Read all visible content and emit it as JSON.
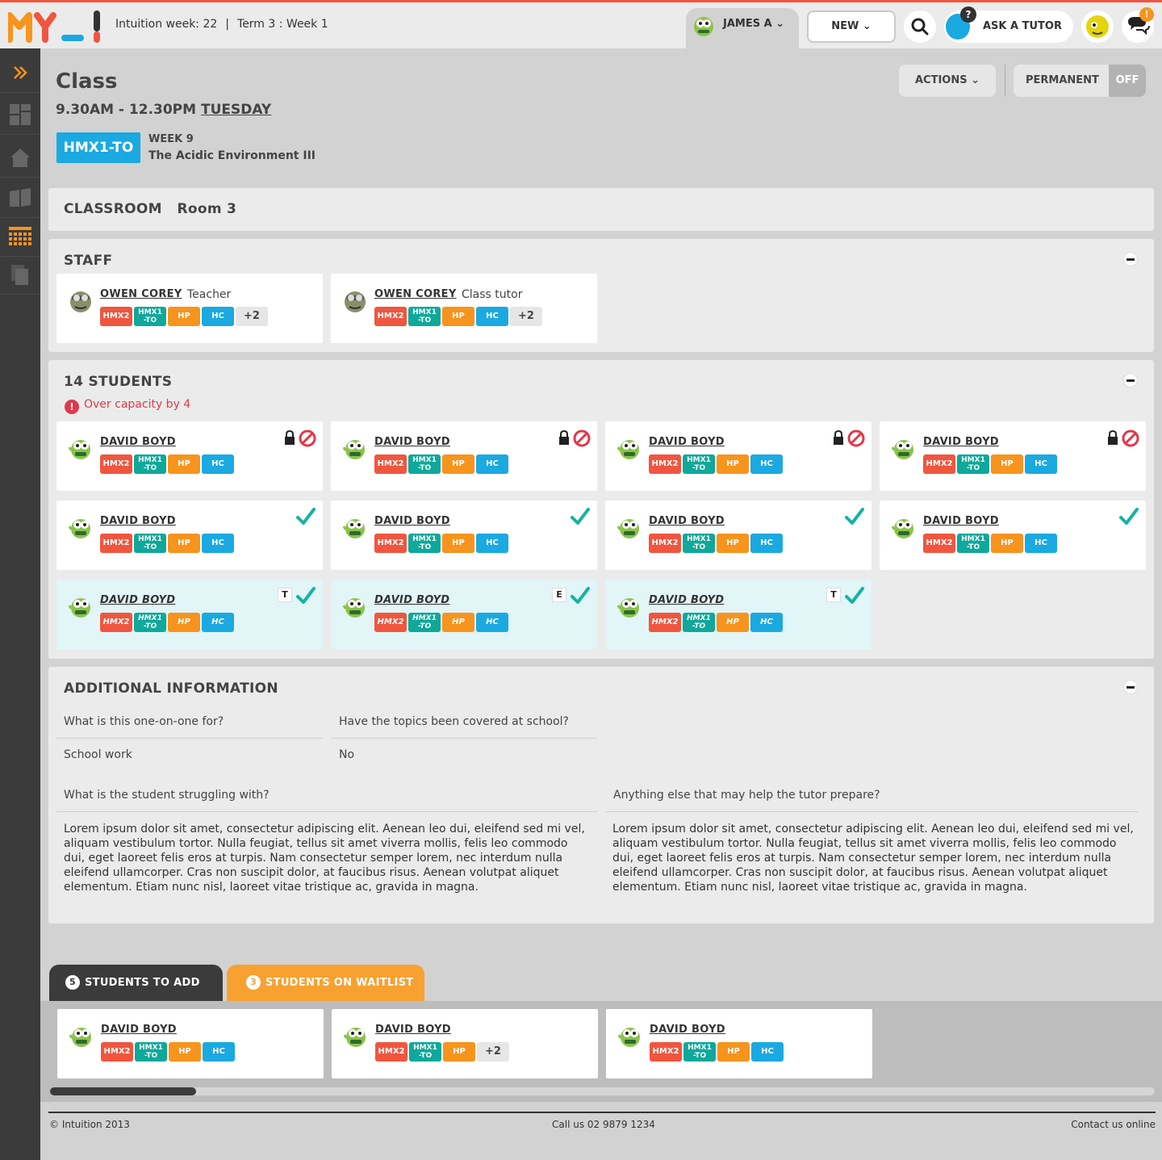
{
  "header": {
    "logo_text": "MY",
    "week_info": "Intuition week: 22",
    "term_info": "Term 3 : Week 1",
    "user_name": "JAMES A",
    "new_label": "NEW",
    "ask_tutor_label": "ASK A TUTOR",
    "help_mark": "?",
    "chat_badge": "!"
  },
  "page": {
    "title": "Class",
    "time_range": "9.30AM - 12.30PM",
    "day": "TUESDAY",
    "class_code": "HMX1-TO",
    "week_label": "WEEK 9",
    "topic": "The Acidic Environment III",
    "actions_label": "ACTIONS",
    "permanent_label": "PERMANENT",
    "permanent_state": "OFF"
  },
  "classroom": {
    "label": "CLASSROOM",
    "room": "Room 3"
  },
  "staff": {
    "heading": "STAFF",
    "members": [
      {
        "name": "OWEN COREY",
        "role": "Teacher",
        "tags": [
          "HMX2",
          "HMX1 -TO",
          "HP",
          "HC"
        ],
        "more": "+2"
      },
      {
        "name": "OWEN COREY",
        "role": "Class tutor",
        "tags": [
          "HMX2",
          "HMX1 -TO",
          "HP",
          "HC"
        ],
        "more": "+2"
      }
    ]
  },
  "students": {
    "heading": "14 STUDENTS",
    "warning": "Over capacity by 4",
    "warning_icon": "!",
    "list": [
      {
        "name": "DAVID BOYD",
        "tags": [
          "HMX2",
          "HMX1 -TO",
          "HP",
          "HC"
        ],
        "status": "locked"
      },
      {
        "name": "DAVID BOYD",
        "tags": [
          "HMX2",
          "HMX1 -TO",
          "HP",
          "HC"
        ],
        "status": "locked"
      },
      {
        "name": "DAVID BOYD",
        "tags": [
          "HMX2",
          "HMX1 -TO",
          "HP",
          "HC"
        ],
        "status": "locked"
      },
      {
        "name": "DAVID BOYD",
        "tags": [
          "HMX2",
          "HMX1 -TO",
          "HP",
          "HC"
        ],
        "status": "locked"
      },
      {
        "name": "DAVID BOYD",
        "tags": [
          "HMX2",
          "HMX1 -TO",
          "HP",
          "HC"
        ],
        "status": "checked"
      },
      {
        "name": "DAVID BOYD",
        "tags": [
          "HMX2",
          "HMX1 -TO",
          "HP",
          "HC"
        ],
        "status": "checked"
      },
      {
        "name": "DAVID BOYD",
        "tags": [
          "HMX2",
          "HMX1 -TO",
          "HP",
          "HC"
        ],
        "status": "checked"
      },
      {
        "name": "DAVID BOYD",
        "tags": [
          "HMX2",
          "HMX1 -TO",
          "HP",
          "HC"
        ],
        "status": "checked"
      },
      {
        "name": "DAVID BOYD",
        "tags": [
          "HMX2",
          "HMX1 -TO",
          "HP",
          "HC"
        ],
        "status": "checked",
        "mark": "T"
      },
      {
        "name": "DAVID BOYD",
        "tags": [
          "HMX2",
          "HMX1 -TO",
          "HP",
          "HC"
        ],
        "status": "checked",
        "mark": "E"
      },
      {
        "name": "DAVID BOYD",
        "tags": [
          "HMX2",
          "HMX1 -TO",
          "HP",
          "HC"
        ],
        "status": "checked",
        "mark": "T"
      }
    ]
  },
  "additional": {
    "heading": "ADDITIONAL INFORMATION",
    "q1": "What is this one-on-one for?",
    "a1": "School work",
    "q2": "Have the topics been covered at school?",
    "a2": "No",
    "q3": "What is the student struggling with?",
    "a3": "Lorem ipsum dolor sit amet, consectetur adipiscing elit. Aenean leo dui, eleifend sed mi vel, aliquam vestibulum tortor. Nulla feugiat, tellus sit amet viverra mollis, felis leo commodo dui, eget laoreet felis eros at turpis. Nam consectetur semper lorem, nec interdum nulla eleifend ullamcorper. Cras non suscipit dolor, at faucibus risus. Aenean volutpat aliquet elementum. Etiam nunc nisl, laoreet vitae tristique ac, gravida in magna.",
    "q4": "Anything else that may help the tutor prepare?",
    "a4": "Lorem ipsum dolor sit amet, consectetur adipiscing elit. Aenean leo dui, eleifend sed mi vel, aliquam vestibulum tortor. Nulla feugiat, tellus sit amet viverra mollis, felis leo commodo dui, eget laoreet felis eros at turpis. Nam consectetur semper lorem, nec interdum nulla eleifend ullamcorper. Cras non suscipit dolor, at faucibus risus. Aenean volutpat aliquet elementum. Etiam nunc nisl, laoreet vitae tristique ac, gravida in magna."
  },
  "tabs": {
    "add_count": "5",
    "add_label": "STUDENTS TO ADD",
    "wait_count": "3",
    "wait_label": "STUDENTS ON WAITLIST"
  },
  "to_add": [
    {
      "name": "DAVID BOYD",
      "tags": [
        "HMX2",
        "HMX1 -TO",
        "HP",
        "HC"
      ]
    },
    {
      "name": "DAVID BOYD",
      "tags": [
        "HMX2",
        "HMX1 -TO",
        "HP"
      ],
      "more": "+2"
    },
    {
      "name": "DAVID BOYD",
      "tags": [
        "HMX2",
        "HMX1 -TO",
        "HP",
        "HC"
      ]
    }
  ],
  "footer": {
    "copyright": "© Intuition 2013",
    "phone": "Call us 02 9879 1234",
    "contact": "Contact us online"
  },
  "colors": {
    "red": "#f0563f",
    "teal": "#0fa89a",
    "orange": "#f7941d",
    "blue": "#1ba9e1",
    "dark": "#3b3b3b",
    "highlight": "#e2f5f7"
  }
}
